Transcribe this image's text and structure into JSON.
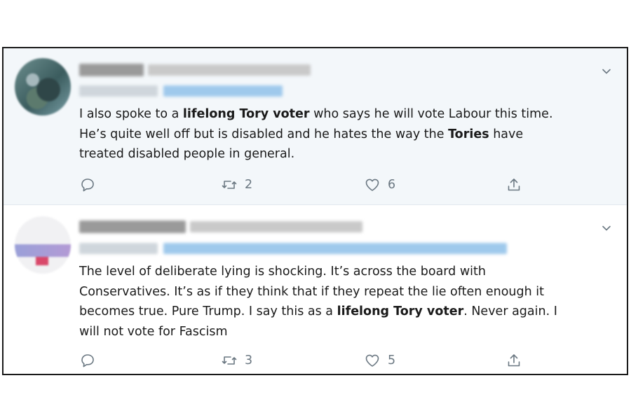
{
  "tweets": [
    {
      "text_parts": [
        {
          "text": "I also spoke to a ",
          "bold": false
        },
        {
          "text": "lifelong Tory voter",
          "bold": true
        },
        {
          "text": " who says he will vote Labour this time.\nHe’s quite well off but is disabled and he hates the way the ",
          "bold": false
        },
        {
          "text": "Tories",
          "bold": true
        },
        {
          "text": " have\ntreated disabled people in general.",
          "bold": false
        }
      ],
      "actions": {
        "reply_icon": "reply-icon",
        "retweet_icon": "retweet-icon",
        "retweet_count": "2",
        "like_icon": "heart-icon",
        "like_count": "6",
        "share_icon": "share-icon"
      },
      "background_color": "#f3f7fa"
    },
    {
      "text_parts": [
        {
          "text": "The level of deliberate lying is shocking. It’s across the board with\nConservatives. It’s as if they think that if they repeat the lie often enough it\nbecomes true. Pure Trump. I say this as a ",
          "bold": false
        },
        {
          "text": "lifelong Tory voter",
          "bold": true
        },
        {
          "text": ". Never again. I\nwill not vote for Fascism",
          "bold": false
        }
      ],
      "actions": {
        "reply_icon": "reply-icon",
        "retweet_icon": "retweet-icon",
        "retweet_count": "3",
        "like_icon": "heart-icon",
        "like_count": "5",
        "share_icon": "share-icon"
      },
      "background_color": "#ffffff"
    }
  ],
  "colors": {
    "text": "#1a1a1a",
    "muted": "#6b7882",
    "mention_blue": "#1da1f2",
    "border": "#1a1a1a"
  }
}
